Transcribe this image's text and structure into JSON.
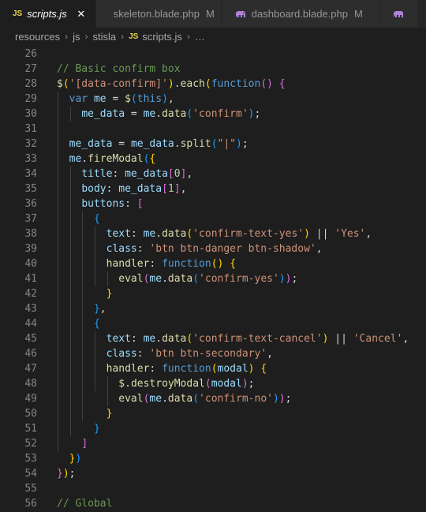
{
  "tabs": [
    {
      "badge": "JS",
      "name": "scripts.js",
      "close": "✕"
    },
    {
      "name": "skeleton.blade.php",
      "status": "M"
    },
    {
      "name": "dashboard.blade.php",
      "status": "M"
    }
  ],
  "breadcrumb": {
    "parts": [
      "resources",
      "js",
      "stisla"
    ],
    "file_badge": "JS",
    "file": "scripts.js",
    "more": "…",
    "separator": "›"
  },
  "line_numbers": [
    "26",
    "27",
    "28",
    "29",
    "30",
    "31",
    "32",
    "33",
    "34",
    "35",
    "36",
    "37",
    "38",
    "39",
    "40",
    "41",
    "42",
    "43",
    "44",
    "45",
    "46",
    "47",
    "48",
    "49",
    "50",
    "51",
    "52",
    "53",
    "54",
    "55",
    "56"
  ],
  "code_lines": [
    [],
    [
      [
        "c-comment",
        "// Basic confirm box"
      ]
    ],
    [
      [
        "c-fn",
        "$"
      ],
      [
        "c-b1",
        "("
      ],
      [
        "c-str",
        "'[data-confirm]'"
      ],
      [
        "c-b1",
        ")"
      ],
      [
        "c-punc",
        "."
      ],
      [
        "c-fn",
        "each"
      ],
      [
        "c-b1",
        "("
      ],
      [
        "c-kw",
        "function"
      ],
      [
        "c-b2",
        "()"
      ],
      [
        "c-punc",
        " "
      ],
      [
        "c-b2",
        "{"
      ]
    ],
    [
      [
        "c-punc",
        "  "
      ],
      [
        "c-kw",
        "var"
      ],
      [
        "c-punc",
        " "
      ],
      [
        "c-var",
        "me"
      ],
      [
        "c-punc",
        " = "
      ],
      [
        "c-fn",
        "$"
      ],
      [
        "c-b3",
        "("
      ],
      [
        "c-kw",
        "this"
      ],
      [
        "c-b3",
        ")"
      ],
      [
        "c-punc",
        ","
      ]
    ],
    [
      [
        "c-punc",
        "    "
      ],
      [
        "c-var",
        "me_data"
      ],
      [
        "c-punc",
        " = "
      ],
      [
        "c-var",
        "me"
      ],
      [
        "c-punc",
        "."
      ],
      [
        "c-fn",
        "data"
      ],
      [
        "c-b3",
        "("
      ],
      [
        "c-str",
        "'confirm'"
      ],
      [
        "c-b3",
        ")"
      ],
      [
        "c-punc",
        ";"
      ]
    ],
    [],
    [
      [
        "c-punc",
        "  "
      ],
      [
        "c-var",
        "me_data"
      ],
      [
        "c-punc",
        " = "
      ],
      [
        "c-var",
        "me_data"
      ],
      [
        "c-punc",
        "."
      ],
      [
        "c-fn",
        "split"
      ],
      [
        "c-b3",
        "("
      ],
      [
        "c-str",
        "\"|\""
      ],
      [
        "c-b3",
        ")"
      ],
      [
        "c-punc",
        ";"
      ]
    ],
    [
      [
        "c-punc",
        "  "
      ],
      [
        "c-var",
        "me"
      ],
      [
        "c-punc",
        "."
      ],
      [
        "c-fn",
        "fireModal"
      ],
      [
        "c-b3",
        "("
      ],
      [
        "c-b1",
        "{"
      ]
    ],
    [
      [
        "c-punc",
        "    "
      ],
      [
        "c-var",
        "title"
      ],
      [
        "c-punc",
        ": "
      ],
      [
        "c-var",
        "me_data"
      ],
      [
        "c-b2",
        "["
      ],
      [
        "c-num",
        "0"
      ],
      [
        "c-b2",
        "]"
      ],
      [
        "c-punc",
        ","
      ]
    ],
    [
      [
        "c-punc",
        "    "
      ],
      [
        "c-var",
        "body"
      ],
      [
        "c-punc",
        ": "
      ],
      [
        "c-var",
        "me_data"
      ],
      [
        "c-b2",
        "["
      ],
      [
        "c-num",
        "1"
      ],
      [
        "c-b2",
        "]"
      ],
      [
        "c-punc",
        ","
      ]
    ],
    [
      [
        "c-punc",
        "    "
      ],
      [
        "c-var",
        "buttons"
      ],
      [
        "c-punc",
        ": "
      ],
      [
        "c-b2",
        "["
      ]
    ],
    [
      [
        "c-punc",
        "      "
      ],
      [
        "c-b3",
        "{"
      ]
    ],
    [
      [
        "c-punc",
        "        "
      ],
      [
        "c-var",
        "text"
      ],
      [
        "c-punc",
        ": "
      ],
      [
        "c-var",
        "me"
      ],
      [
        "c-punc",
        "."
      ],
      [
        "c-fn",
        "data"
      ],
      [
        "c-b1",
        "("
      ],
      [
        "c-str",
        "'confirm-text-yes'"
      ],
      [
        "c-b1",
        ")"
      ],
      [
        "c-punc",
        " || "
      ],
      [
        "c-str",
        "'Yes'"
      ],
      [
        "c-punc",
        ","
      ]
    ],
    [
      [
        "c-punc",
        "        "
      ],
      [
        "c-var",
        "class"
      ],
      [
        "c-punc",
        ": "
      ],
      [
        "c-str",
        "'btn btn-danger btn-shadow'"
      ],
      [
        "c-punc",
        ","
      ]
    ],
    [
      [
        "c-punc",
        "        "
      ],
      [
        "c-fn",
        "handler"
      ],
      [
        "c-punc",
        ": "
      ],
      [
        "c-kw",
        "function"
      ],
      [
        "c-b1",
        "()"
      ],
      [
        "c-punc",
        " "
      ],
      [
        "c-b1",
        "{"
      ]
    ],
    [
      [
        "c-punc",
        "          "
      ],
      [
        "c-fn",
        "eval"
      ],
      [
        "c-b2",
        "("
      ],
      [
        "c-var",
        "me"
      ],
      [
        "c-punc",
        "."
      ],
      [
        "c-fn",
        "data"
      ],
      [
        "c-b3",
        "("
      ],
      [
        "c-str",
        "'confirm-yes'"
      ],
      [
        "c-b3",
        ")"
      ],
      [
        "c-b2",
        ")"
      ],
      [
        "c-punc",
        ";"
      ]
    ],
    [
      [
        "c-punc",
        "        "
      ],
      [
        "c-b1",
        "}"
      ]
    ],
    [
      [
        "c-punc",
        "      "
      ],
      [
        "c-b3",
        "}"
      ],
      [
        "c-punc",
        ","
      ]
    ],
    [
      [
        "c-punc",
        "      "
      ],
      [
        "c-b3",
        "{"
      ]
    ],
    [
      [
        "c-punc",
        "        "
      ],
      [
        "c-var",
        "text"
      ],
      [
        "c-punc",
        ": "
      ],
      [
        "c-var",
        "me"
      ],
      [
        "c-punc",
        "."
      ],
      [
        "c-fn",
        "data"
      ],
      [
        "c-b1",
        "("
      ],
      [
        "c-str",
        "'confirm-text-cancel'"
      ],
      [
        "c-b1",
        ")"
      ],
      [
        "c-punc",
        " || "
      ],
      [
        "c-str",
        "'Cancel'"
      ],
      [
        "c-punc",
        ","
      ]
    ],
    [
      [
        "c-punc",
        "        "
      ],
      [
        "c-var",
        "class"
      ],
      [
        "c-punc",
        ": "
      ],
      [
        "c-str",
        "'btn btn-secondary'"
      ],
      [
        "c-punc",
        ","
      ]
    ],
    [
      [
        "c-punc",
        "        "
      ],
      [
        "c-fn",
        "handler"
      ],
      [
        "c-punc",
        ": "
      ],
      [
        "c-kw",
        "function"
      ],
      [
        "c-b1",
        "("
      ],
      [
        "c-var",
        "modal"
      ],
      [
        "c-b1",
        ")"
      ],
      [
        "c-punc",
        " "
      ],
      [
        "c-b1",
        "{"
      ]
    ],
    [
      [
        "c-punc",
        "          "
      ],
      [
        "c-fn",
        "$"
      ],
      [
        "c-punc",
        "."
      ],
      [
        "c-fn",
        "destroyModal"
      ],
      [
        "c-b2",
        "("
      ],
      [
        "c-var",
        "modal"
      ],
      [
        "c-b2",
        ")"
      ],
      [
        "c-punc",
        ";"
      ]
    ],
    [
      [
        "c-punc",
        "          "
      ],
      [
        "c-fn",
        "eval"
      ],
      [
        "c-b2",
        "("
      ],
      [
        "c-var",
        "me"
      ],
      [
        "c-punc",
        "."
      ],
      [
        "c-fn",
        "data"
      ],
      [
        "c-b3",
        "("
      ],
      [
        "c-str",
        "'confirm-no'"
      ],
      [
        "c-b3",
        ")"
      ],
      [
        "c-b2",
        ")"
      ],
      [
        "c-punc",
        ";"
      ]
    ],
    [
      [
        "c-punc",
        "        "
      ],
      [
        "c-b1",
        "}"
      ]
    ],
    [
      [
        "c-punc",
        "      "
      ],
      [
        "c-b3",
        "}"
      ]
    ],
    [
      [
        "c-punc",
        "    "
      ],
      [
        "c-b2",
        "]"
      ]
    ],
    [
      [
        "c-punc",
        "  "
      ],
      [
        "c-b1",
        "}"
      ],
      [
        "c-b3",
        ")"
      ]
    ],
    [
      [
        "c-b2",
        "}"
      ],
      [
        "c-b1",
        ")"
      ],
      [
        "c-punc",
        ";"
      ]
    ],
    [],
    [
      [
        "c-comment",
        "// Global"
      ]
    ]
  ]
}
